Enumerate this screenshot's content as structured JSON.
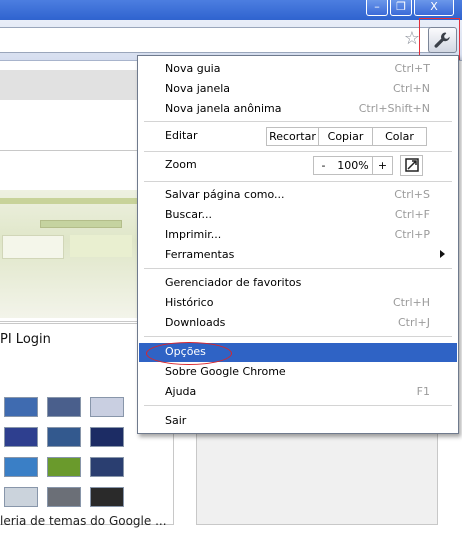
{
  "window": {
    "minimize_icon": "minimize-icon",
    "maximize_icon": "restore-icon",
    "close_label": "X"
  },
  "toolbar": {
    "star_icon": "bookmark-star-icon",
    "wrench_icon": "wrench-icon"
  },
  "page": {
    "tile_login_label": "PI Login",
    "tile_themes_label": "leria de temas do Google ..."
  },
  "menu": {
    "new_tab": {
      "label": "Nova guia",
      "shortcut": "Ctrl+T"
    },
    "new_window": {
      "label": "Nova janela",
      "shortcut": "Ctrl+N"
    },
    "new_incognito": {
      "label": "Nova janela anônima",
      "shortcut": "Ctrl+Shift+N"
    },
    "edit": {
      "label": "Editar",
      "cut": "Recortar",
      "copy": "Copiar",
      "paste": "Colar"
    },
    "zoom": {
      "label": "Zoom",
      "minus": "-",
      "value": "100%",
      "plus": "+",
      "fullscreen_icon": "fullscreen-icon"
    },
    "save_page": {
      "label": "Salvar página como...",
      "shortcut": "Ctrl+S"
    },
    "find": {
      "label": "Buscar...",
      "shortcut": "Ctrl+F"
    },
    "print": {
      "label": "Imprimir...",
      "shortcut": "Ctrl+P"
    },
    "tools": {
      "label": "Ferramentas",
      "arrow_icon": "submenu-arrow-icon"
    },
    "bookmark_manager": {
      "label": "Gerenciador de favoritos"
    },
    "history": {
      "label": "Histórico",
      "shortcut": "Ctrl+H"
    },
    "downloads": {
      "label": "Downloads",
      "shortcut": "Ctrl+J"
    },
    "options": {
      "label": "Opções",
      "highlighted": true
    },
    "about": {
      "label": "Sobre Google Chrome"
    },
    "help": {
      "label": "Ajuda",
      "shortcut": "F1"
    },
    "exit": {
      "label": "Sair"
    }
  },
  "colors": {
    "highlight": "#2f63c5",
    "annotation_red": "#d8262c",
    "titlebar_blue": "#2f63cf"
  }
}
